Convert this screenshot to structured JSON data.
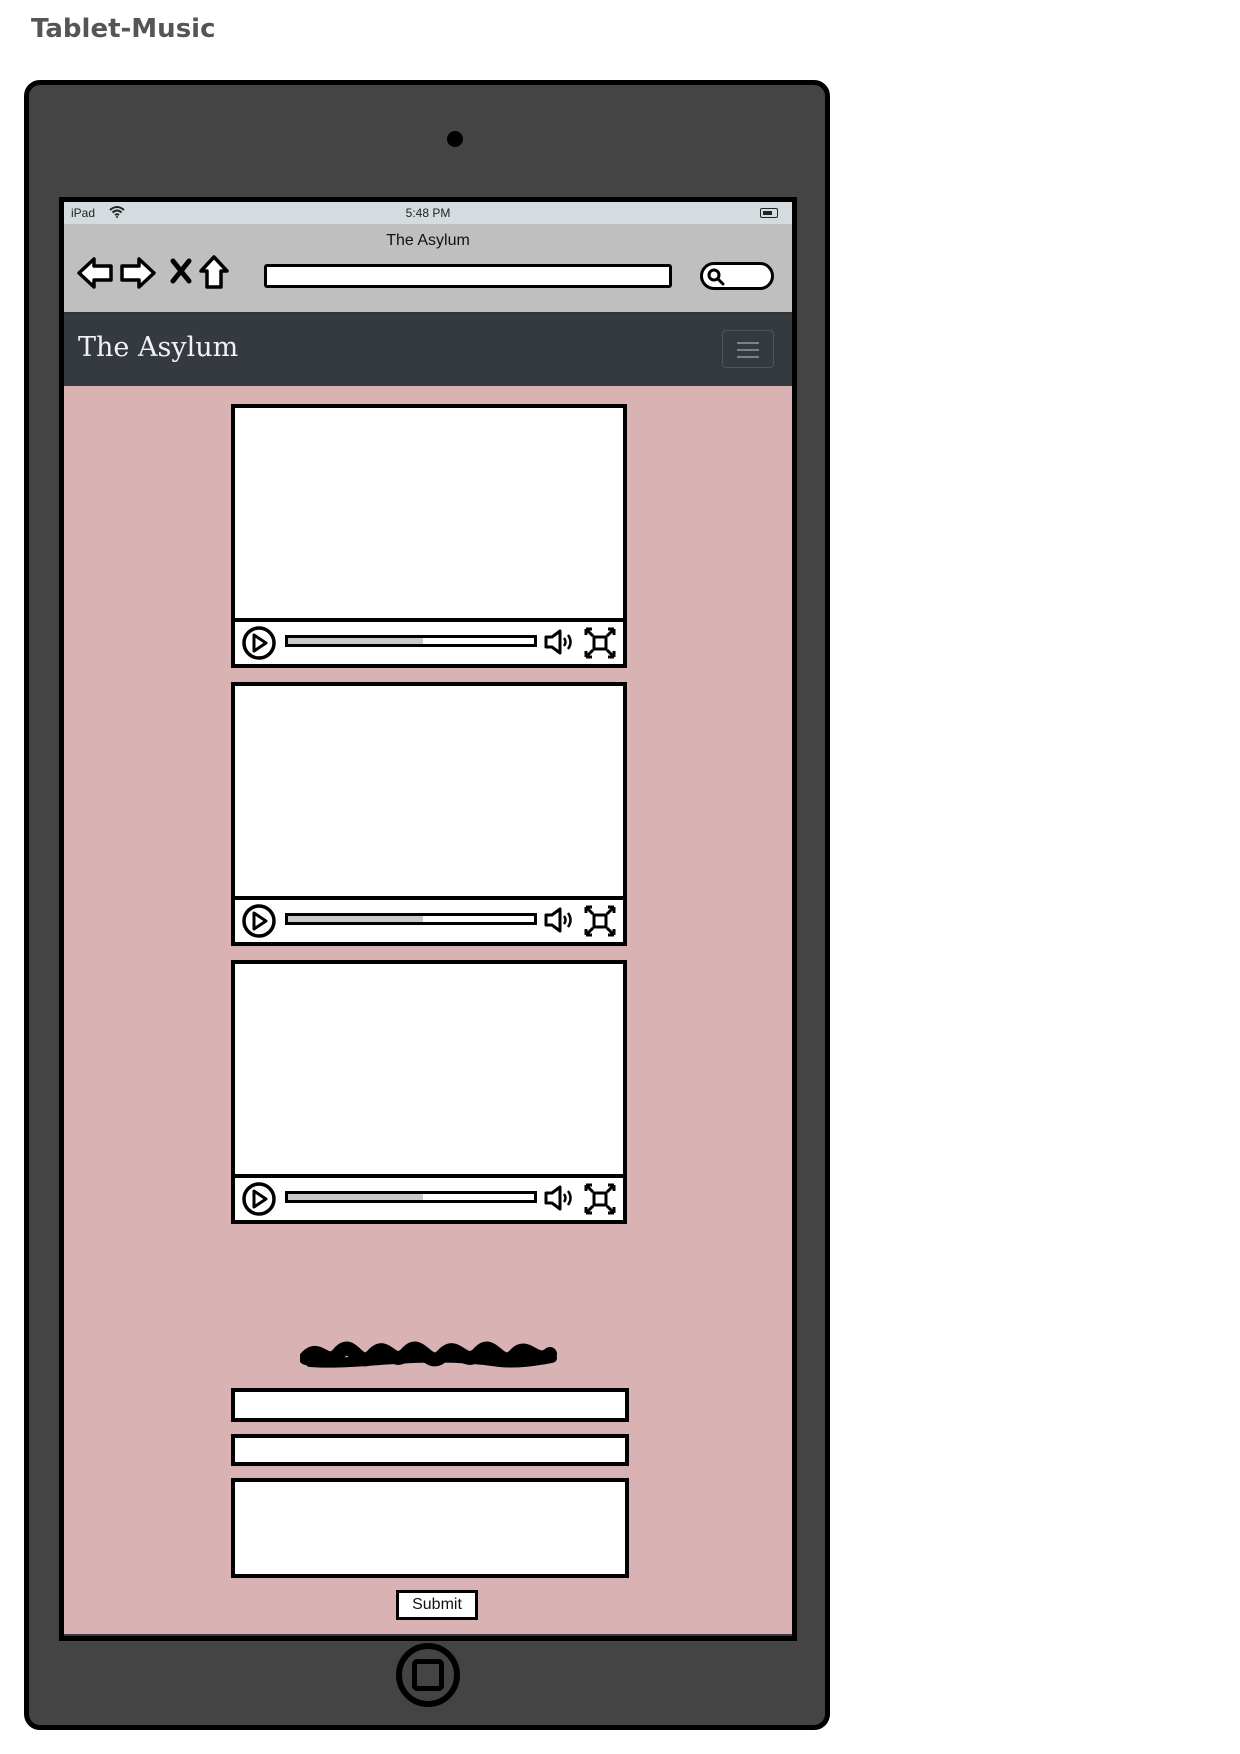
{
  "page": {
    "title": "Tablet-Music"
  },
  "status_bar": {
    "carrier": "iPad",
    "time": "5:48 PM"
  },
  "browser": {
    "title": "The Asylum",
    "url": ""
  },
  "site": {
    "brand": "The Asylum"
  },
  "videos": [
    {
      "progress": 0.55
    },
    {
      "progress": 0.55
    },
    {
      "progress": 0.55
    }
  ],
  "form": {
    "submit_label": "Submit"
  },
  "footer": {
    "icons": [
      "facebook-icon",
      "instagram-icon",
      "youtube-icon",
      "twitter-icon"
    ]
  },
  "colors": {
    "device": "#444444",
    "page_background": "#d9b3b3",
    "navbar": "#343a40",
    "browser_chrome": "#bfbfbf",
    "status_bar": "#d4dce0"
  }
}
